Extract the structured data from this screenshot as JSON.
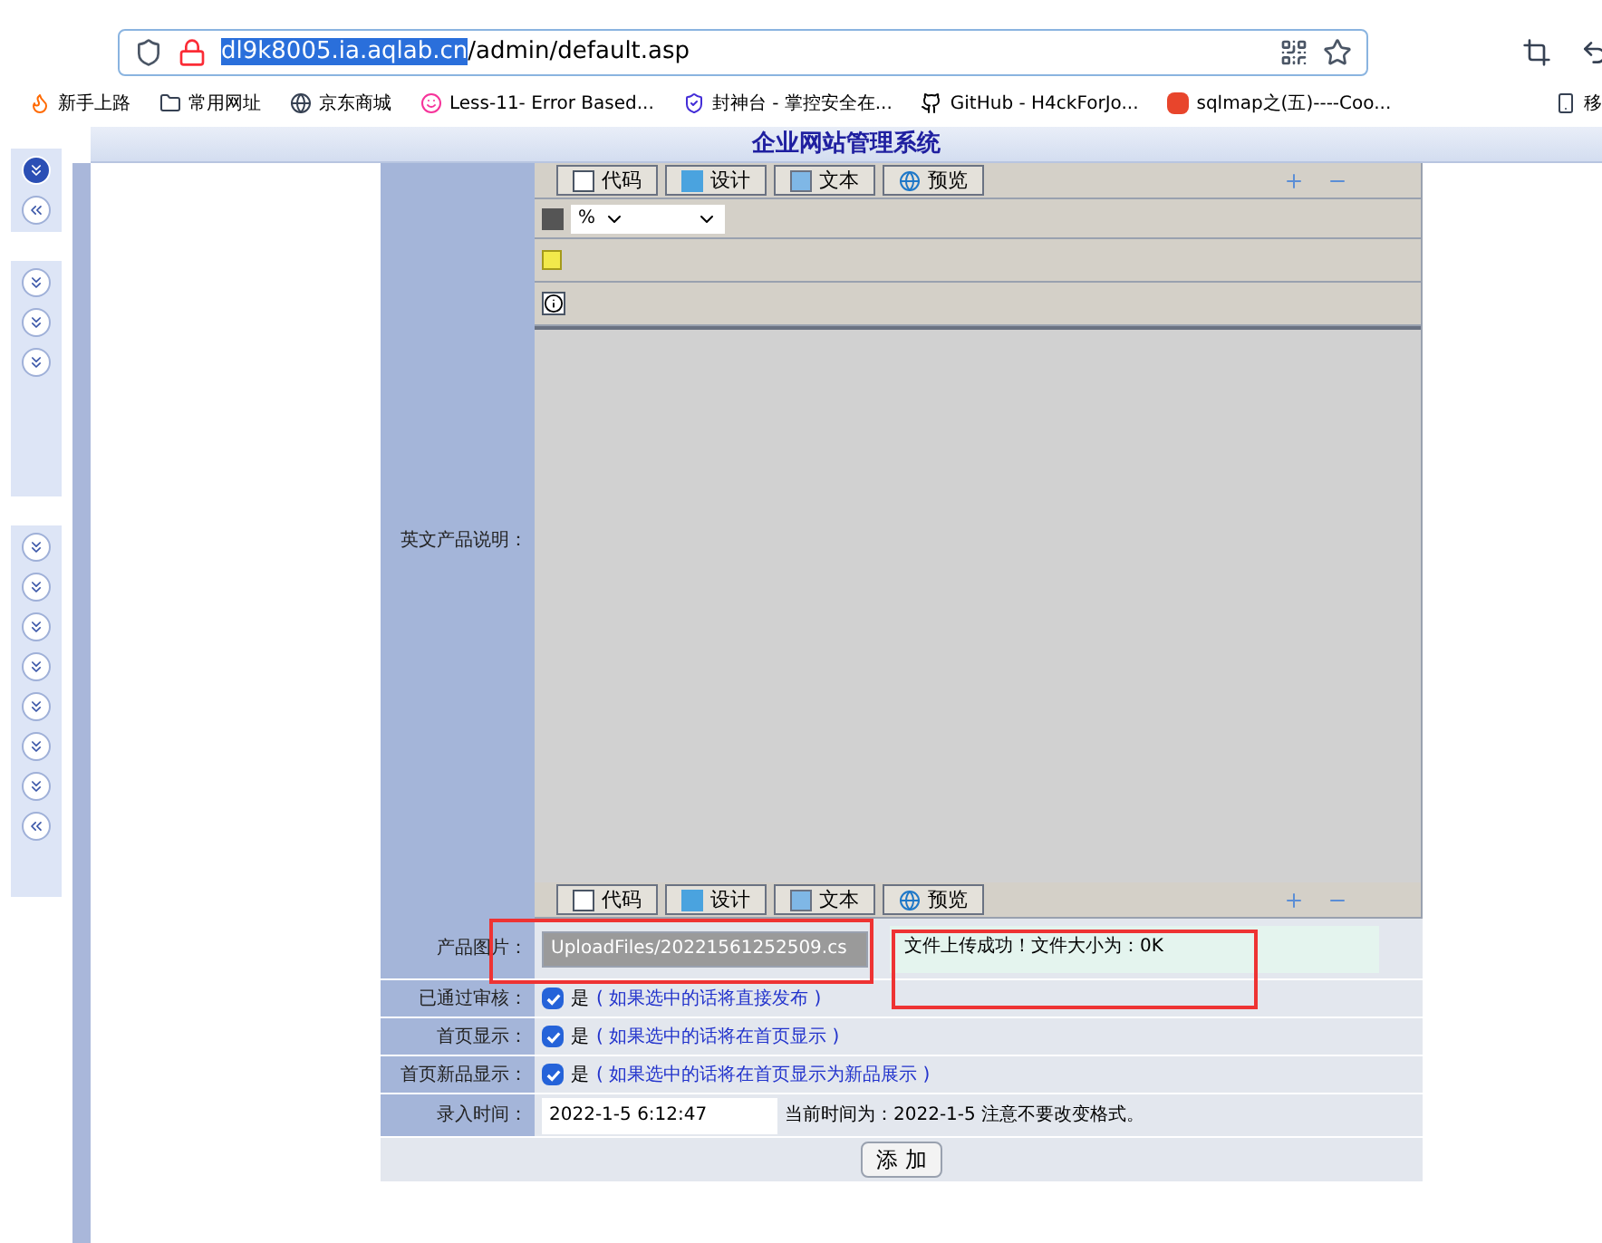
{
  "browser": {
    "url_host": "dl9k8005.ia.aqlab.cn",
    "url_path": "/admin/default.asp",
    "bookmarks": [
      {
        "kind": "fire",
        "label": "新手上路"
      },
      {
        "kind": "folder",
        "label": "常用网址"
      },
      {
        "kind": "globe",
        "label": "京东商城"
      },
      {
        "kind": "smile",
        "label": "Less-11- Error Based..."
      },
      {
        "kind": "shield",
        "label": "封神台 - 掌控安全在..."
      },
      {
        "kind": "github",
        "label": "GitHub - H4ckForJo..."
      },
      {
        "kind": "csdn",
        "label": "sqlmap之(五)----Coo..."
      },
      {
        "kind": "device",
        "label": "移"
      }
    ]
  },
  "page_title": "企业网站管理系统",
  "sidebar": {
    "groups": [
      {
        "buttons": [
          {
            "kind": "down",
            "selected": true
          },
          {
            "kind": "left",
            "selected": false
          }
        ]
      },
      {
        "buttons": [
          {
            "kind": "down",
            "selected": false
          },
          {
            "kind": "down",
            "selected": false
          },
          {
            "kind": "down",
            "selected": false
          }
        ]
      },
      {
        "buttons": [
          {
            "kind": "down",
            "selected": false
          },
          {
            "kind": "down",
            "selected": false
          },
          {
            "kind": "down",
            "selected": false
          },
          {
            "kind": "down",
            "selected": false
          },
          {
            "kind": "down",
            "selected": false
          },
          {
            "kind": "down",
            "selected": false
          },
          {
            "kind": "down",
            "selected": false
          },
          {
            "kind": "left",
            "selected": false
          }
        ]
      }
    ]
  },
  "editor": {
    "label": "英文产品说明：",
    "top_tabs": [
      {
        "kind": "code",
        "label": "代码"
      },
      {
        "kind": "design",
        "label": "设计"
      },
      {
        "kind": "text",
        "label": "文本"
      },
      {
        "kind": "preview",
        "label": "预览"
      }
    ],
    "size_select": "%",
    "bottom_tabs": [
      {
        "kind": "code",
        "label": "代码"
      },
      {
        "kind": "design",
        "label": "设计"
      },
      {
        "kind": "text",
        "label": "文本"
      },
      {
        "kind": "preview",
        "label": "预览"
      }
    ]
  },
  "image_row": {
    "label": "产品图片：",
    "value": "UploadFiles/20221561252509.cs",
    "message": "文件上传成功！文件大小为：0K"
  },
  "check_rows": [
    {
      "label": "已通过审核：",
      "checked": true,
      "option": "是",
      "hint": "( 如果选中的话将直接发布 )"
    },
    {
      "label": "首页显示：",
      "checked": true,
      "option": "是",
      "hint": "( 如果选中的话将在首页显示 )"
    },
    {
      "label": "首页新品显示：",
      "checked": true,
      "option": "是",
      "hint": "( 如果选中的话将在首页显示为新品展示 )"
    }
  ],
  "time_row": {
    "label": "录入时间：",
    "value": "2022-1-5 6:12:47",
    "note": "当前时间为：2022-1-5 注意不要改变格式。"
  },
  "submit": "添 加"
}
